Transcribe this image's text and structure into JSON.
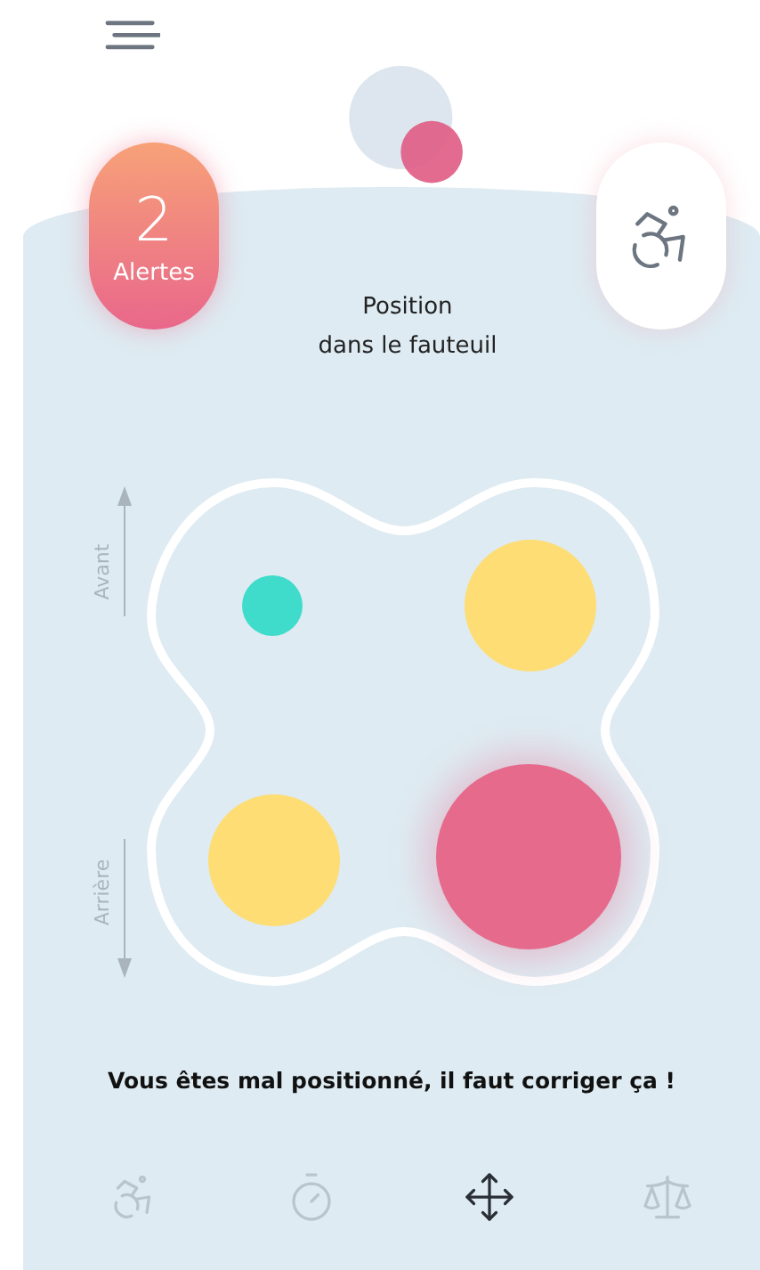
{
  "alerts": {
    "count": "2",
    "label": "Alertes"
  },
  "title_lines": [
    "Position",
    "dans le fauteuil"
  ],
  "axis_labels": {
    "front": "Avant",
    "back": "Arrière"
  },
  "sensors": [
    {
      "color": "#3fdccb",
      "kind": "low"
    },
    {
      "color": "#fedd75",
      "kind": "medium"
    },
    {
      "color": "#fedd75",
      "kind": "medium"
    },
    {
      "color": "#e56a8c",
      "kind": "high"
    }
  ],
  "message": "Vous êtes mal positionné, il faut corriger ça !",
  "nav": [
    {
      "kind": "wheelchair",
      "selected": false
    },
    {
      "kind": "timer",
      "selected": false
    },
    {
      "kind": "move",
      "selected": true
    },
    {
      "kind": "scale",
      "selected": false
    }
  ]
}
